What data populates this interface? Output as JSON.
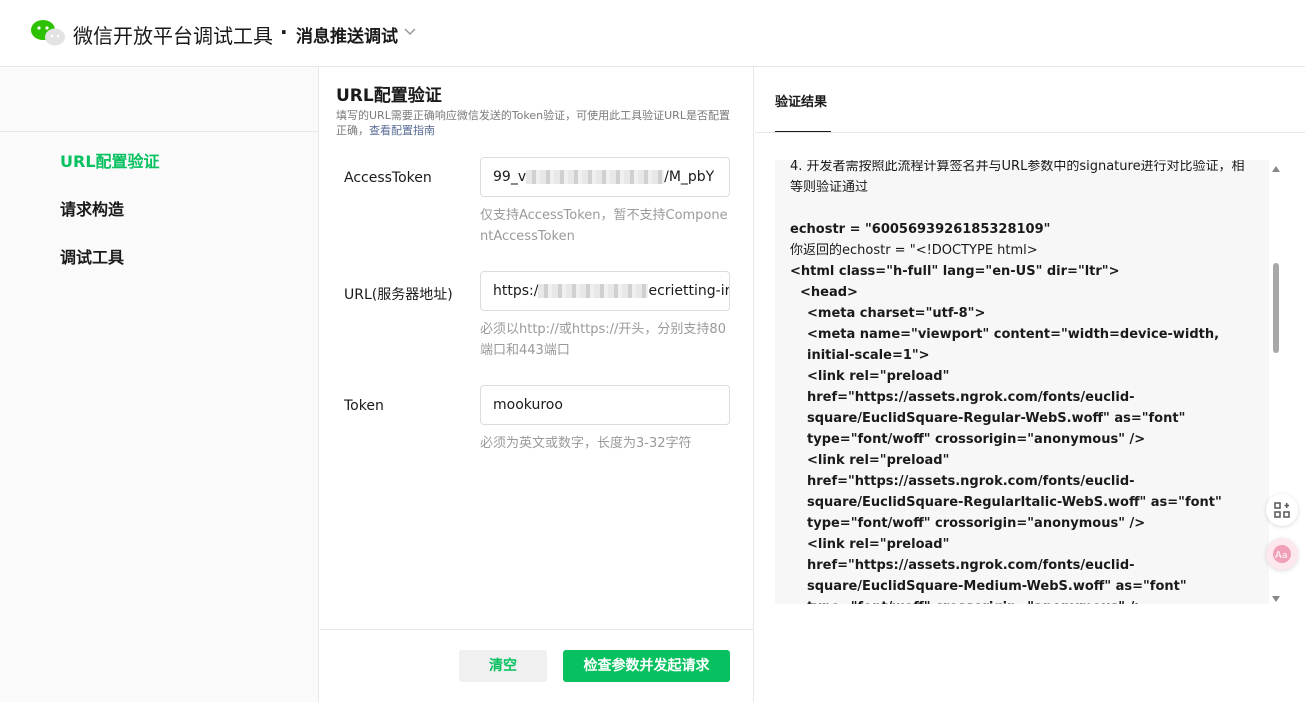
{
  "header": {
    "app_title": "微信开放平台调试工具",
    "separator": "·",
    "subtitle": "消息推送调试"
  },
  "sidebar": {
    "items": [
      {
        "label": "URL配置验证",
        "active": true
      },
      {
        "label": "请求构造",
        "active": false
      },
      {
        "label": "调试工具",
        "active": false
      }
    ]
  },
  "form": {
    "title": "URL配置验证",
    "desc": "填写的URL需要正确响应微信发送的Token验证，可使用此工具验证URL是否配置正确，",
    "desc_link": "查看配置指南",
    "fields": [
      {
        "label": "AccessToken",
        "value_start": "99_v",
        "value_end": "/M_pbY",
        "hint": "仅支持AccessToken，暂不支持ComponentAccessToken"
      },
      {
        "label": "URL(服务器地址)",
        "value_start": "https:/",
        "value_end": "ecrietting-ir",
        "hint": "必须以http://或https://开头，分别支持80端口和443端口"
      },
      {
        "label": "Token",
        "value": "mookuroo",
        "hint": "必须为英文或数字，长度为3-32字符"
      }
    ],
    "clear_label": "清空",
    "submit_label": "检查参数并发起请求"
  },
  "result": {
    "tab_label": "验证结果",
    "lines": [
      "4. 开发者需按照此流程计算签名并与URL参数中的signature进行对比验证，相等则验证通过",
      "echostr = \"6005693926185328109\"",
      "你返回的echostr = \"<!DOCTYPE html>",
      "<html class=\"h-full\" lang=\"en-US\" dir=\"ltr\">",
      "<head>",
      "<meta charset=\"utf-8\">",
      "<meta name=\"viewport\" content=\"width=device-width, initial-scale=1\">",
      "<link rel=\"preload\" href=\"https://assets.ngrok.com/fonts/euclid-square/EuclidSquare-Regular-WebS.woff\" as=\"font\" type=\"font/woff\" crossorigin=\"anonymous\" />",
      "<link rel=\"preload\" href=\"https://assets.ngrok.com/fonts/euclid-square/EuclidSquare-RegularItalic-WebS.woff\" as=\"font\" type=\"font/woff\" crossorigin=\"anonymous\" />",
      "<link rel=\"preload\" href=\"https://assets.ngrok.com/fonts/euclid-square/EuclidSquare-Medium-WebS.woff\" as=\"font\" type=\"font/woff\" crossorigin=\"anonymous\" />"
    ]
  },
  "colors": {
    "accent": "#07c160",
    "link": "#576b95"
  },
  "icons": [
    "wechat-logo-icon",
    "chevron-down-icon",
    "qr-grid-icon",
    "translate-icon",
    "scroll-up-icon",
    "scroll-down-icon"
  ]
}
